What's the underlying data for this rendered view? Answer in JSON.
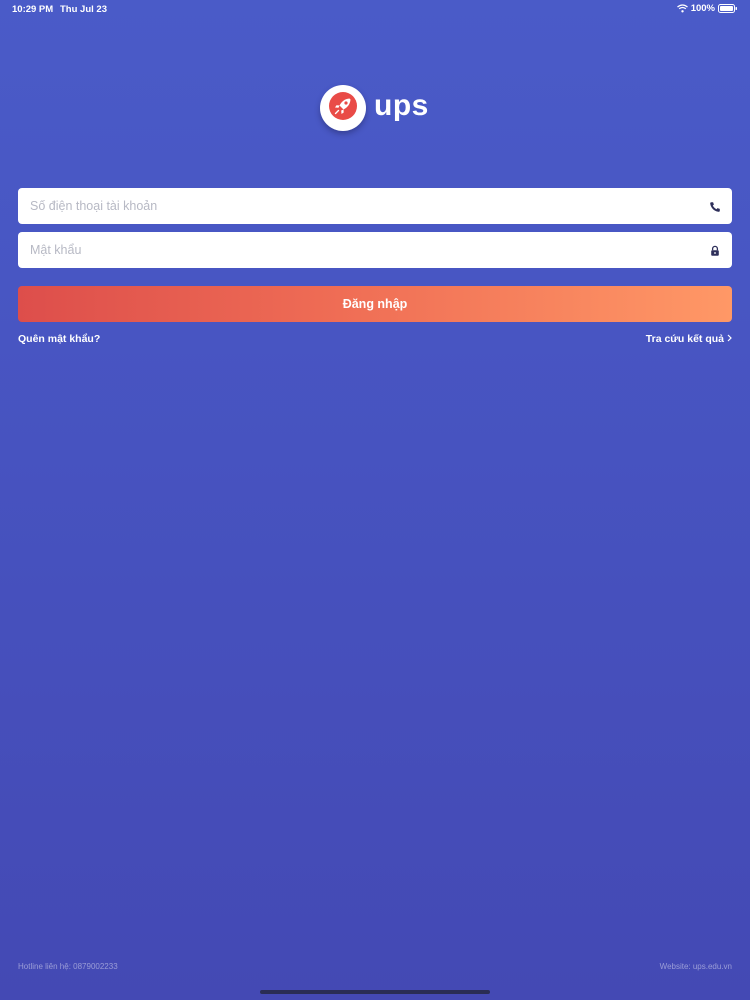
{
  "status_bar": {
    "time": "10:29 PM",
    "date": "Thu Jul 23",
    "battery": "100%"
  },
  "brand": {
    "name": "ups",
    "icon": "rocket-icon",
    "accent_color": "#e94b47"
  },
  "login_form": {
    "phone_placeholder": "Số điện thoại tài khoản",
    "phone_value": "",
    "phone_icon": "phone-icon",
    "password_placeholder": "Mật khẩu",
    "password_value": "",
    "password_icon": "lock-icon",
    "submit_label": "Đăng nhập"
  },
  "links": {
    "forgot_password": "Quên mật khẩu?",
    "lookup_results": "Tra cứu kết quả",
    "lookup_icon": "chevron-right-icon"
  },
  "footer": {
    "hotline": "Hotline liên hệ: 0879002233",
    "website": "Website: ups.edu.vn"
  },
  "colors": {
    "background": "#4a56c4",
    "button_start": "#dd4e4b",
    "button_end": "#ff9866"
  }
}
